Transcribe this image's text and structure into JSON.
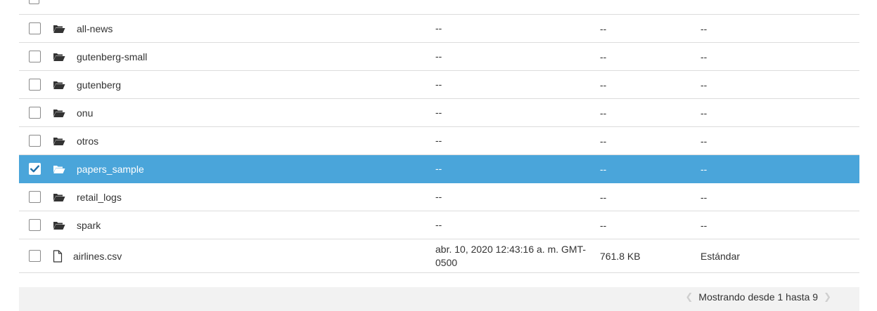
{
  "rows": [
    {
      "name": "all-news",
      "date": "--",
      "size": "--",
      "storage_class": "--",
      "type": "folder",
      "selected": false
    },
    {
      "name": "gutenberg-small",
      "date": "--",
      "size": "--",
      "storage_class": "--",
      "type": "folder",
      "selected": false
    },
    {
      "name": "gutenberg",
      "date": "--",
      "size": "--",
      "storage_class": "--",
      "type": "folder",
      "selected": false
    },
    {
      "name": "onu",
      "date": "--",
      "size": "--",
      "storage_class": "--",
      "type": "folder",
      "selected": false
    },
    {
      "name": "otros",
      "date": "--",
      "size": "--",
      "storage_class": "--",
      "type": "folder",
      "selected": false
    },
    {
      "name": "papers_sample",
      "date": "--",
      "size": "--",
      "storage_class": "--",
      "type": "folder",
      "selected": true
    },
    {
      "name": "retail_logs",
      "date": "--",
      "size": "--",
      "storage_class": "--",
      "type": "folder",
      "selected": false
    },
    {
      "name": "spark",
      "date": "--",
      "size": "--",
      "storage_class": "--",
      "type": "folder",
      "selected": false
    },
    {
      "name": "airlines.csv",
      "date": "abr. 10, 2020 12:43:16 a. m. GMT-0500",
      "size": "761.8 KB",
      "storage_class": "Estándar",
      "type": "file",
      "selected": false
    }
  ],
  "footer": {
    "pagination_text": "Mostrando desde 1 hasta 9",
    "prev_icon": "chevron-left-icon",
    "next_icon": "chevron-right-icon"
  },
  "colors": {
    "selected_row": "#4aa5da",
    "footer_bg": "#f2f2f2",
    "divider": "#dcdcdc"
  }
}
